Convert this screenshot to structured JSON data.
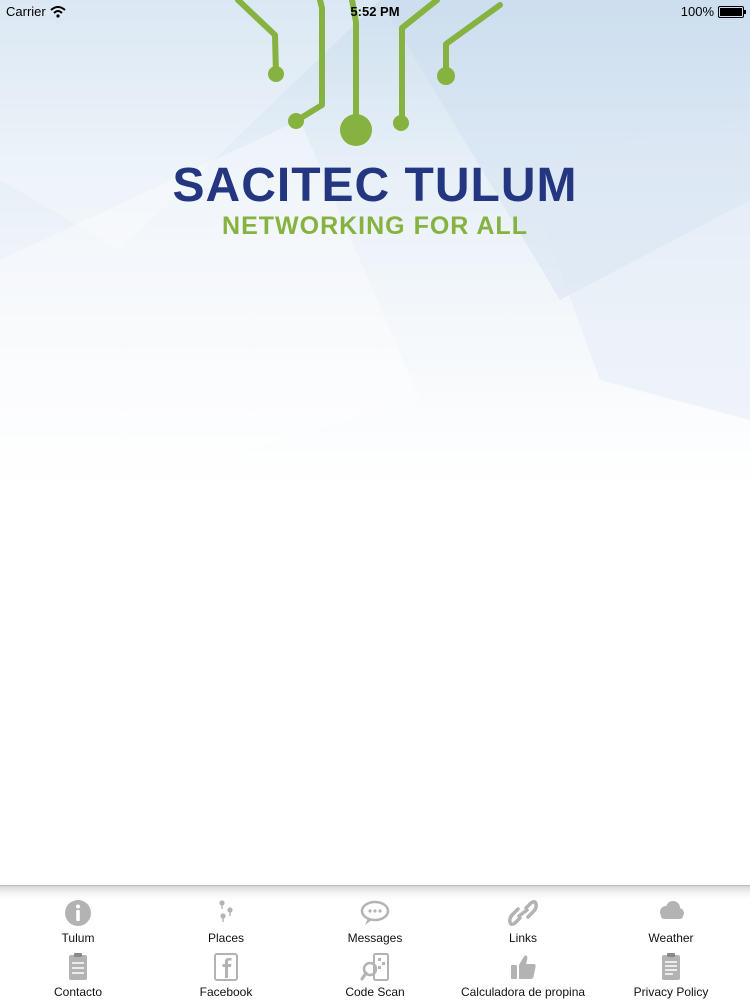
{
  "status_bar": {
    "carrier": "Carrier",
    "time": "5:52 PM",
    "battery": "100%"
  },
  "logo": {
    "brand": "SACITEC TULUM",
    "tagline": "NETWORKING FOR ALL"
  },
  "colors": {
    "brand_blue": "#23367f",
    "brand_green": "#86b23f",
    "icon_gray": "#b0b0b0"
  },
  "tabs_row1": [
    {
      "label": "Tulum",
      "icon": "info-icon"
    },
    {
      "label": "Places",
      "icon": "map-pins-icon"
    },
    {
      "label": "Messages",
      "icon": "chat-bubble-icon"
    },
    {
      "label": "Links",
      "icon": "chain-link-icon"
    },
    {
      "label": "Weather",
      "icon": "cloud-icon"
    }
  ],
  "tabs_row2": [
    {
      "label": "Contacto",
      "icon": "clipboard-icon"
    },
    {
      "label": "Facebook",
      "icon": "facebook-icon"
    },
    {
      "label": "Code Scan",
      "icon": "qr-scan-icon"
    },
    {
      "label": "Calculadora de propina",
      "icon": "thumbs-up-icon"
    },
    {
      "label": "Privacy Policy",
      "icon": "document-icon"
    }
  ]
}
